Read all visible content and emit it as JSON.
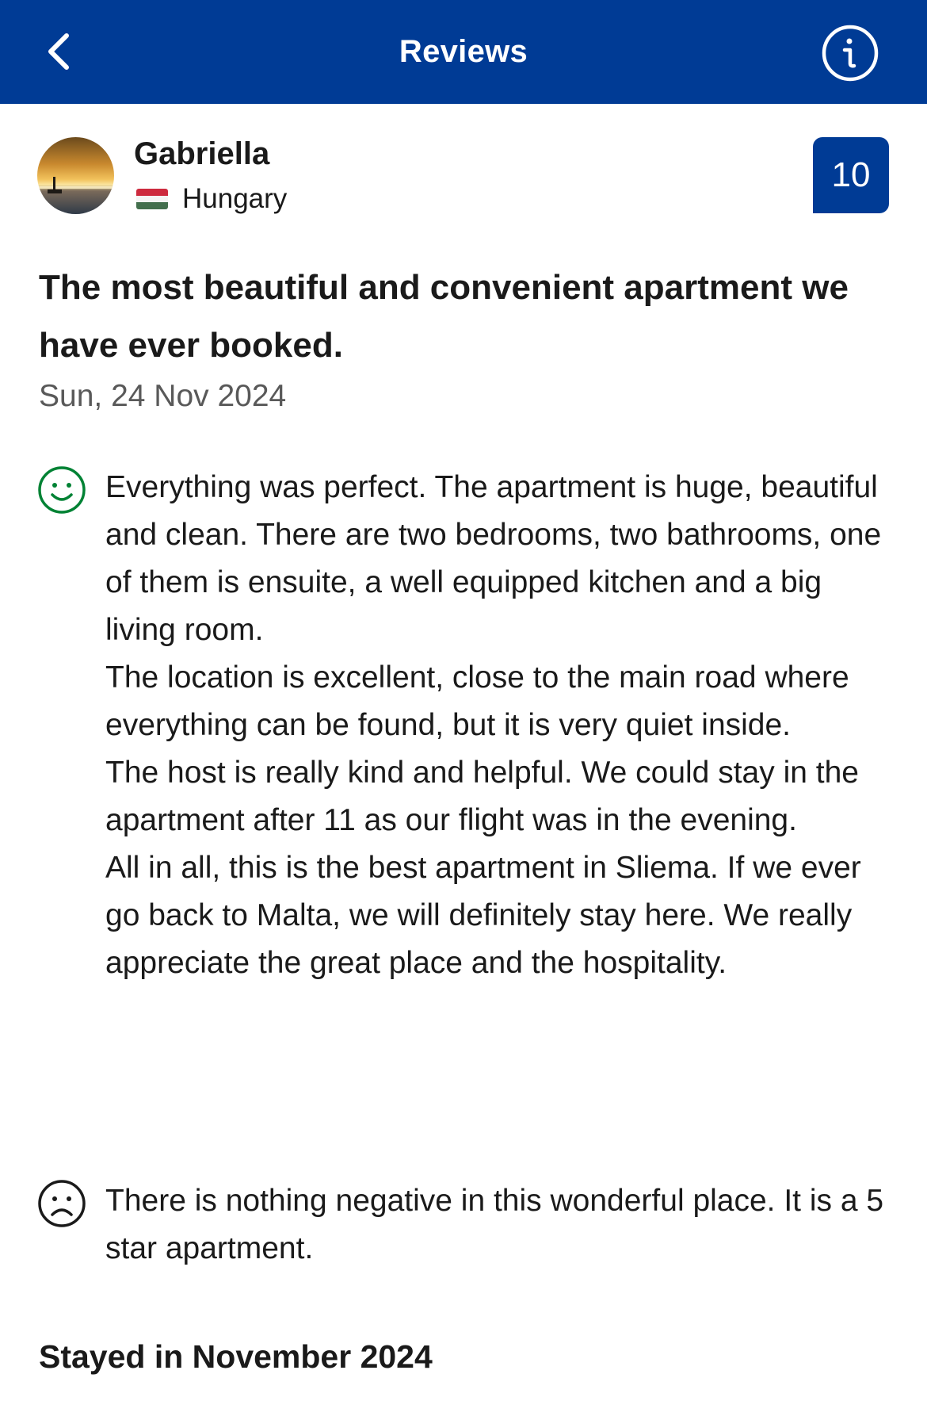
{
  "header": {
    "title": "Reviews",
    "back_icon": "chevron-left-icon",
    "info_icon": "info-icon",
    "background_color": "#003b95"
  },
  "reviewer": {
    "name": "Gabriella",
    "country": "Hungary",
    "flag_icon": "hungary-flag-icon",
    "avatar": "sunset-photo-avatar"
  },
  "score": {
    "value": "10",
    "badge_color": "#003b95"
  },
  "review": {
    "title": "The most beautiful and convenient apartment we have ever booked.",
    "date": "Sun, 24 Nov 2024",
    "positive": {
      "icon": "smiley-happy-icon",
      "icon_color": "#008234",
      "paragraphs": [
        "Everything was perfect. The apartment is huge, beautiful and clean. There are two bedrooms, two bathrooms, one of them is ensuite, a well equipped kitchen and a big living room.",
        "The location is excellent, close to the main road where everything can be found,  but it is very quiet inside.",
        "The host is really kind and helpful. We could stay in the apartment after 11 as our flight was in the evening.",
        "All in all, this is the best apartment in Sliema. If we ever go back to Malta, we will definitely stay here. We really appreciate the great place and the hospitality."
      ]
    },
    "negative": {
      "icon": "smiley-sad-icon",
      "icon_color": "#1a1a1a",
      "paragraphs": [
        "There is nothing negative in this wonderful place. It is a 5 star apartment."
      ]
    },
    "stayed": "Stayed in November 2024"
  }
}
